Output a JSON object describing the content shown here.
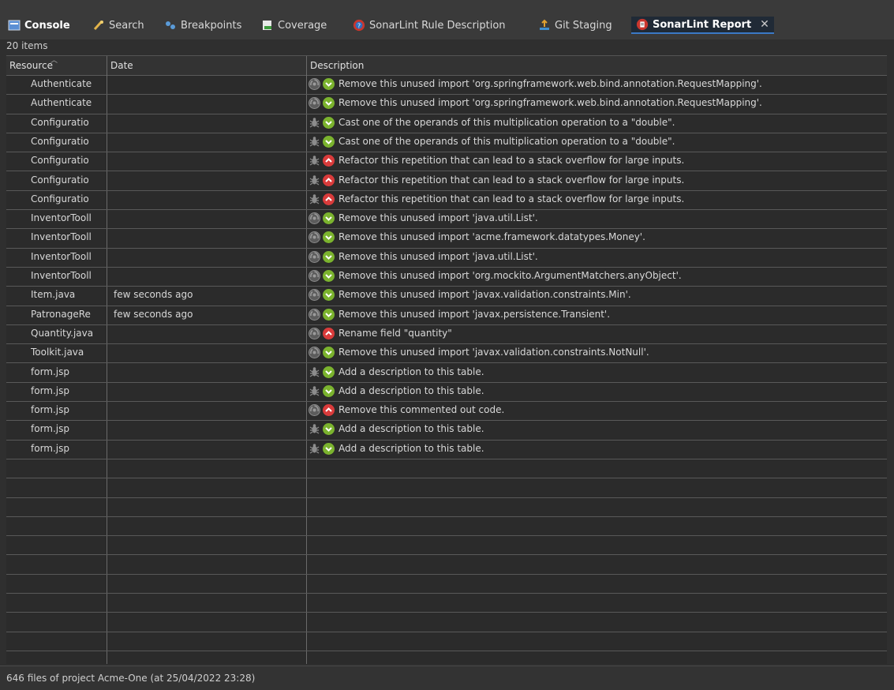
{
  "tabs": [
    {
      "label": "Console",
      "icon": "console-icon"
    },
    {
      "label": "Search",
      "icon": "search-icon"
    },
    {
      "label": "Breakpoints",
      "icon": "breakpoints-icon"
    },
    {
      "label": "Coverage",
      "icon": "coverage-icon"
    },
    {
      "label": "SonarLint Rule Description",
      "icon": "sonarlint-rule-icon"
    },
    {
      "label": "Git Staging",
      "icon": "git-staging-icon"
    },
    {
      "label": "SonarLint Report",
      "icon": "sonarlint-report-icon"
    }
  ],
  "item_count": "20 items",
  "columns": {
    "resource": "Resource",
    "date": "Date",
    "description": "Description"
  },
  "rows": [
    {
      "resource": "Authenticate",
      "date": "",
      "type": "smell",
      "severity": "minor",
      "description": "Remove this unused import 'org.springframework.web.bind.annotation.RequestMapping'."
    },
    {
      "resource": "Authenticate",
      "date": "",
      "type": "smell",
      "severity": "minor",
      "description": "Remove this unused import 'org.springframework.web.bind.annotation.RequestMapping'."
    },
    {
      "resource": "Configuratio",
      "date": "",
      "type": "bug",
      "severity": "minor",
      "description": "Cast one of the operands of this multiplication operation to a \"double\"."
    },
    {
      "resource": "Configuratio",
      "date": "",
      "type": "bug",
      "severity": "minor",
      "description": "Cast one of the operands of this multiplication operation to a \"double\"."
    },
    {
      "resource": "Configuratio",
      "date": "",
      "type": "bug",
      "severity": "major",
      "description": "Refactor this repetition that can lead to a stack overflow for large inputs."
    },
    {
      "resource": "Configuratio",
      "date": "",
      "type": "bug",
      "severity": "major",
      "description": "Refactor this repetition that can lead to a stack overflow for large inputs."
    },
    {
      "resource": "Configuratio",
      "date": "",
      "type": "bug",
      "severity": "major",
      "description": "Refactor this repetition that can lead to a stack overflow for large inputs."
    },
    {
      "resource": "InventorTooll",
      "date": "",
      "type": "smell",
      "severity": "minor",
      "description": "Remove this unused import 'java.util.List'."
    },
    {
      "resource": "InventorTooll",
      "date": "",
      "type": "smell",
      "severity": "minor",
      "description": "Remove this unused import 'acme.framework.datatypes.Money'."
    },
    {
      "resource": "InventorTooll",
      "date": "",
      "type": "smell",
      "severity": "minor",
      "description": "Remove this unused import 'java.util.List'."
    },
    {
      "resource": "InventorTooll",
      "date": "",
      "type": "smell",
      "severity": "minor",
      "description": "Remove this unused import 'org.mockito.ArgumentMatchers.anyObject'."
    },
    {
      "resource": "Item.java",
      "date": "few seconds ago",
      "type": "smell",
      "severity": "minor",
      "description": "Remove this unused import 'javax.validation.constraints.Min'."
    },
    {
      "resource": "PatronageRe",
      "date": "few seconds ago",
      "type": "smell",
      "severity": "minor",
      "description": "Remove this unused import 'javax.persistence.Transient'."
    },
    {
      "resource": "Quantity.java",
      "date": "",
      "type": "smell",
      "severity": "major",
      "description": "Rename field \"quantity\""
    },
    {
      "resource": "Toolkit.java",
      "date": "",
      "type": "smell",
      "severity": "minor",
      "description": "Remove this unused import 'javax.validation.constraints.NotNull'."
    },
    {
      "resource": "form.jsp",
      "date": "",
      "type": "bug",
      "severity": "minor",
      "description": "Add a description to this table."
    },
    {
      "resource": "form.jsp",
      "date": "",
      "type": "bug",
      "severity": "minor",
      "description": "Add a description to this table."
    },
    {
      "resource": "form.jsp",
      "date": "",
      "type": "smell",
      "severity": "major",
      "description": "Remove this commented out code."
    },
    {
      "resource": "form.jsp",
      "date": "",
      "type": "bug",
      "severity": "minor",
      "description": "Add a description to this table."
    },
    {
      "resource": "form.jsp",
      "date": "",
      "type": "bug",
      "severity": "minor",
      "description": "Add a description to this table."
    }
  ],
  "status": "646 files of project Acme-One (at 25/04/2022 23:28)",
  "colors": {
    "background": "#2b2b2b",
    "minor": "#7bb32e",
    "major": "#d93b3b",
    "active_tab_underline": "#3b79c6"
  }
}
